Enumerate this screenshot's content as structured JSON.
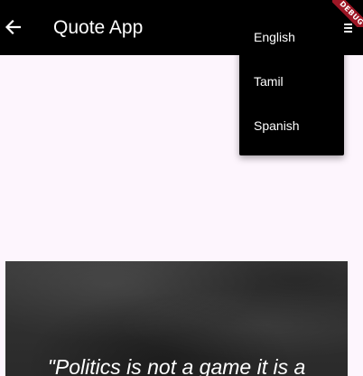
{
  "appbar": {
    "title": "Quote App",
    "back_icon": "arrow-left-icon",
    "menu_icon": "menu-icon",
    "background": "#000000"
  },
  "debug_banner": {
    "label": "DEBUG",
    "color": "#9e1726"
  },
  "language_menu": {
    "items": [
      {
        "label": "English"
      },
      {
        "label": "Tamil"
      },
      {
        "label": "Spanish"
      }
    ]
  },
  "quote": {
    "text": "\"Politics is not a game it is a"
  },
  "colors": {
    "page_background": "#fdf5fd",
    "menu_background": "#000000"
  }
}
